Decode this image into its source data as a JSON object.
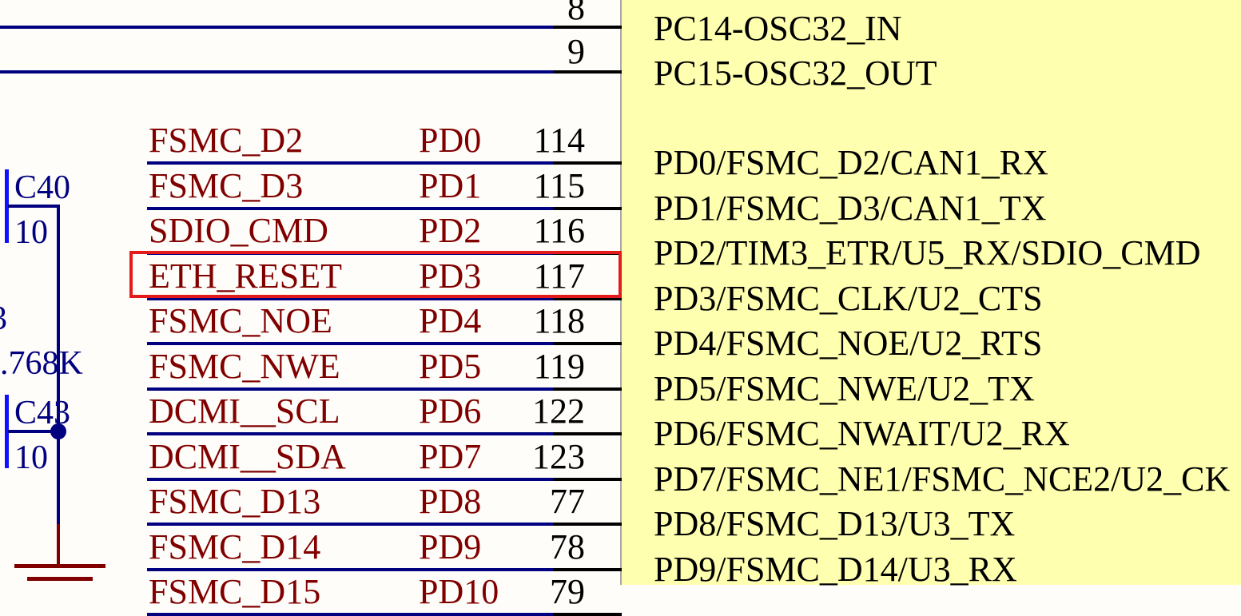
{
  "top_pins": [
    {
      "num": "8",
      "func": ""
    },
    {
      "num": "9",
      "func": "PC14-OSC32_IN"
    },
    {
      "num": "",
      "func": "PC15-OSC32_OUT"
    }
  ],
  "pins": [
    {
      "net": "FSMC_D2",
      "port": "PD0",
      "num": "114",
      "func": "PD0/FSMC_D2/CAN1_RX"
    },
    {
      "net": "FSMC_D3",
      "port": "PD1",
      "num": "115",
      "func": "PD1/FSMC_D3/CAN1_TX"
    },
    {
      "net": "SDIO_CMD",
      "port": "PD2",
      "num": "116",
      "func": "PD2/TIM3_ETR/U5_RX/SDIO_CMD"
    },
    {
      "net": "ETH_RESET",
      "port": "PD3",
      "num": "117",
      "func": "PD3/FSMC_CLK/U2_CTS"
    },
    {
      "net": "FSMC_NOE",
      "port": "PD4",
      "num": "118",
      "func": "PD4/FSMC_NOE/U2_RTS"
    },
    {
      "net": "FSMC_NWE",
      "port": "PD5",
      "num": "119",
      "func": "PD5/FSMC_NWE/U2_TX"
    },
    {
      "net": "DCMI__SCL",
      "port": "PD6",
      "num": "122",
      "func": "PD6/FSMC_NWAIT/U2_RX"
    },
    {
      "net": "DCMI__SDA",
      "port": "PD7",
      "num": "123",
      "func": "PD7/FSMC_NE1/FSMC_NCE2/U2_CK"
    },
    {
      "net": "FSMC_D13",
      "port": "PD8",
      "num": "77",
      "func": "PD8/FSMC_D13/U3_TX"
    },
    {
      "net": "FSMC_D14",
      "port": "PD9",
      "num": "78",
      "func": "PD9/FSMC_D14/U3_RX"
    },
    {
      "net": "FSMC_D15",
      "port": "PD10",
      "num": "79",
      "func": ""
    }
  ],
  "components": {
    "c40_ref": "C40",
    "c40_value": "10",
    "c43_ref": "C43",
    "c43_value": "10",
    "crystal_fragment": "3",
    "crystal_value": ".768K"
  },
  "highlighted_pin": "ETH_RESET",
  "colors": {
    "net_label": "#800000",
    "wire": "#000080",
    "chip_fill": "#ffffb0",
    "highlight": "#e51b1b"
  }
}
